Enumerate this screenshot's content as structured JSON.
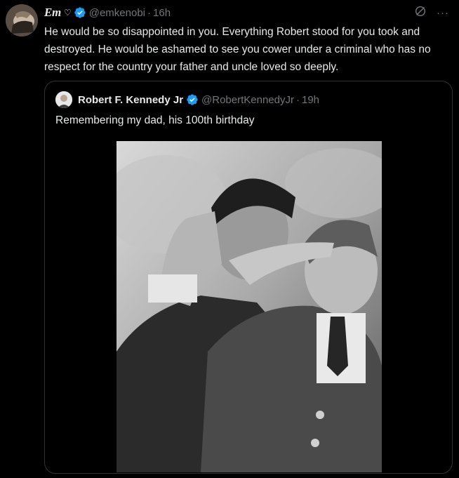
{
  "tweet": {
    "display_name": "Em",
    "name_emoji": "♡",
    "handle": "@emkenobi",
    "separator": "·",
    "time": "16h",
    "text": "He would be so disappointed in you. Everything Robert stood for you took and destroyed. He would be ashamed to see you cower under a criminal who has no respect for the country your father and uncle loved so deeply.",
    "more_label": "···",
    "grok_icon": "grok-icon",
    "verified_icon": "verified-badge-icon"
  },
  "quote": {
    "display_name": "Robert F. Kennedy Jr",
    "handle": "@RobertKennedyJr",
    "separator": "·",
    "time": "19h",
    "text": "Remembering my dad, his 100th birthday",
    "photo": "black-and-white photo of a man and a young boy saluting"
  },
  "colors": {
    "background": "#000000",
    "text": "#e7e9ea",
    "muted": "#71767b",
    "border": "#2f3336",
    "verified": "#1d9bf0"
  }
}
